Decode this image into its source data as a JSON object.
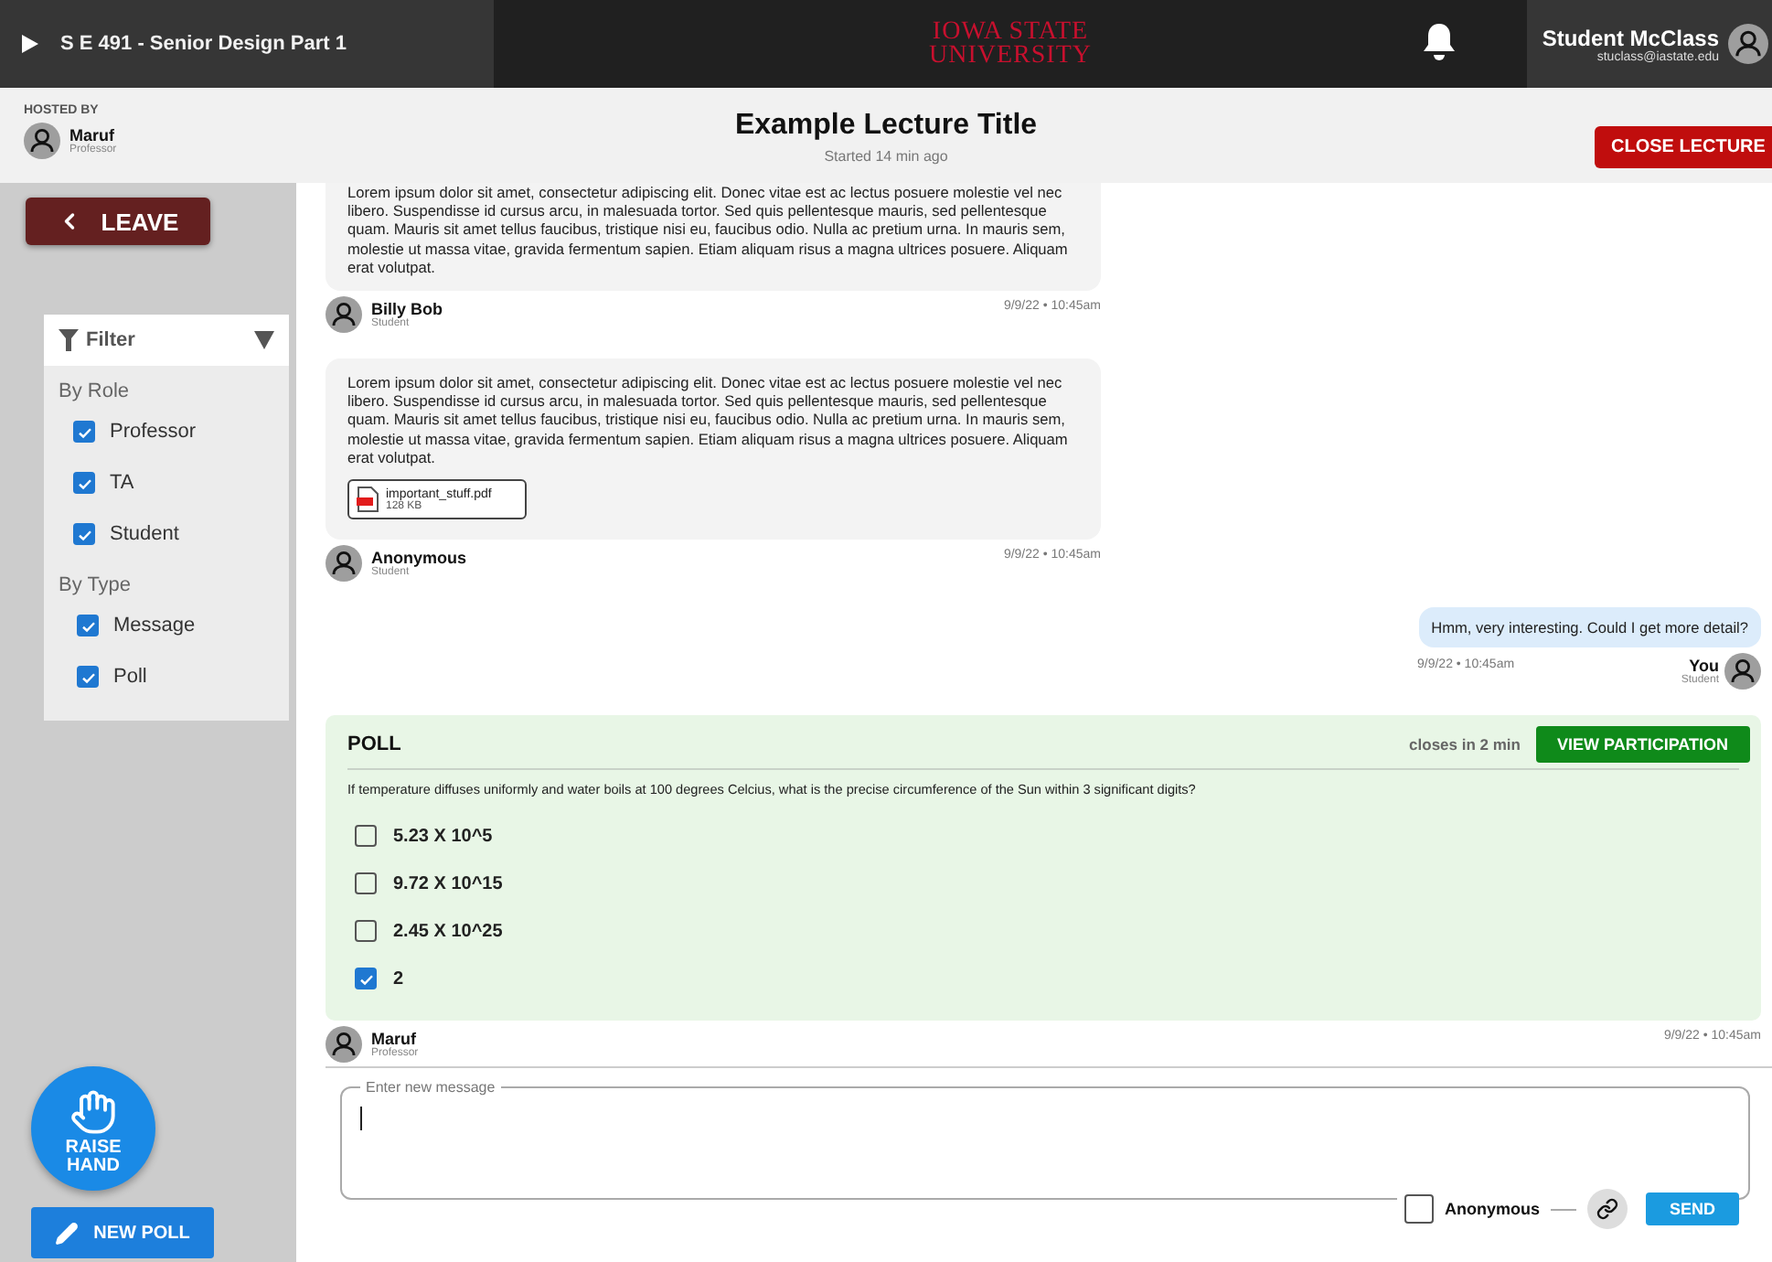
{
  "topbar": {
    "course": "S E 491 - Senior Design Part 1",
    "logo_line_1": "IOWA STATE",
    "logo_line_2": "UNIVERSITY",
    "user_name": "Student McClass",
    "user_email": "stuclass@iastate.edu"
  },
  "lecture": {
    "hosted_by_label": "HOSTED BY",
    "host_name": "Maruf",
    "host_role": "Professor",
    "title": "Example Lecture Title",
    "started": "Started 14 min ago",
    "close_button": "CLOSE LECTURE"
  },
  "sidebar": {
    "leave_button": "LEAVE",
    "filter": {
      "title": "Filter",
      "expanded": true,
      "groups": [
        {
          "label": "By Role",
          "options": [
            {
              "label": "Professor",
              "checked": true
            },
            {
              "label": "TA",
              "checked": true
            },
            {
              "label": "Student",
              "checked": true
            }
          ]
        },
        {
          "label": "By Type",
          "options": [
            {
              "label": "Message",
              "checked": true
            },
            {
              "label": "Poll",
              "checked": true
            }
          ]
        }
      ]
    },
    "raise_hand": "RAISE HAND",
    "new_poll_button": "NEW POLL"
  },
  "feed": [
    {
      "kind": "message",
      "mine": false,
      "text": "Lorem ipsum dolor sit amet, consectetur adipiscing elit. Donec vitae est ac lectus posuere molestie vel nec libero. Suspendisse id cursus arcu, in malesuada tortor. Sed quis pellentesque mauris, sed pellentesque quam. Mauris sit amet tellus faucibus, tristique nisi eu, faucibus odio. Nulla ac pretium urna. In mauris sem, molestie ut massa vitae, gravida fermentum sapien. Etiam aliquam risus a magna ultrices posuere. Aliquam erat volutpat.",
      "author": "Billy Bob",
      "role": "Student",
      "time": "9/9/22 • 10:45am"
    },
    {
      "kind": "message",
      "mine": false,
      "text": "Lorem ipsum dolor sit amet, consectetur adipiscing elit. Donec vitae est ac lectus posuere molestie vel nec libero. Suspendisse id cursus arcu, in malesuada tortor. Sed quis pellentesque mauris, sed pellentesque quam. Mauris sit amet tellus faucibus, tristique nisi eu, faucibus odio. Nulla ac pretium urna. In mauris sem, molestie ut massa vitae, gravida fermentum sapien. Etiam aliquam risus a magna ultrices posuere. Aliquam erat volutpat.",
      "attachment": {
        "name": "important_stuff.pdf",
        "size": "128 KB"
      },
      "author": "Anonymous",
      "role": "Student",
      "time": "9/9/22 • 10:45am"
    },
    {
      "kind": "message",
      "mine": true,
      "text": "Hmm, very interesting. Could I get more detail?",
      "author": "You",
      "role": "Student",
      "time": "9/9/22 • 10:45am"
    },
    {
      "kind": "poll",
      "title": "POLL",
      "closes": "closes in 2 min",
      "button": "VIEW PARTICIPATION",
      "question": "If temperature diffuses uniformly and water boils at 100 degrees Celcius, what is the precise circumference of the Sun within 3 significant digits?",
      "options": [
        {
          "label": "5.23 X 10^5",
          "checked": false
        },
        {
          "label": "9.72 X 10^15",
          "checked": false
        },
        {
          "label": "2.45 X 10^25",
          "checked": false
        },
        {
          "label": "2",
          "checked": true
        }
      ],
      "author": "Maruf",
      "role": "Professor",
      "time": "9/9/22 • 10:45am"
    }
  ],
  "composer": {
    "label": "Enter new message",
    "anonymous": {
      "label": "Anonymous",
      "checked": false
    },
    "send_button": "SEND"
  }
}
